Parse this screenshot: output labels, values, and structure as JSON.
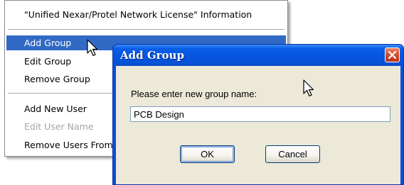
{
  "context_menu": {
    "header": "\"Unified Nexar/Protel Network License\" Information",
    "items": [
      {
        "label": "Add Group",
        "state": "selected"
      },
      {
        "label": "Edit Group",
        "state": "normal"
      },
      {
        "label": "Remove Group",
        "state": "normal"
      },
      {
        "label": "Add New User",
        "state": "normal"
      },
      {
        "label": "Edit User Name",
        "state": "disabled"
      },
      {
        "label": "Remove Users From Group",
        "state": "normal"
      }
    ]
  },
  "dialog": {
    "title": "Add Group",
    "prompt": "Please enter new group name:",
    "input_value": "PCB Design",
    "ok_label": "OK",
    "cancel_label": "Cancel"
  },
  "icons": {
    "close": "close-icon",
    "pointer": "mouse-pointer-icon"
  },
  "colors": {
    "menu_selection": "#316ac5",
    "titlebar": "#0754e0",
    "dialog_face": "#ece9d8",
    "close_button": "#cf4a2a",
    "disabled_text": "#a3a3a3"
  }
}
